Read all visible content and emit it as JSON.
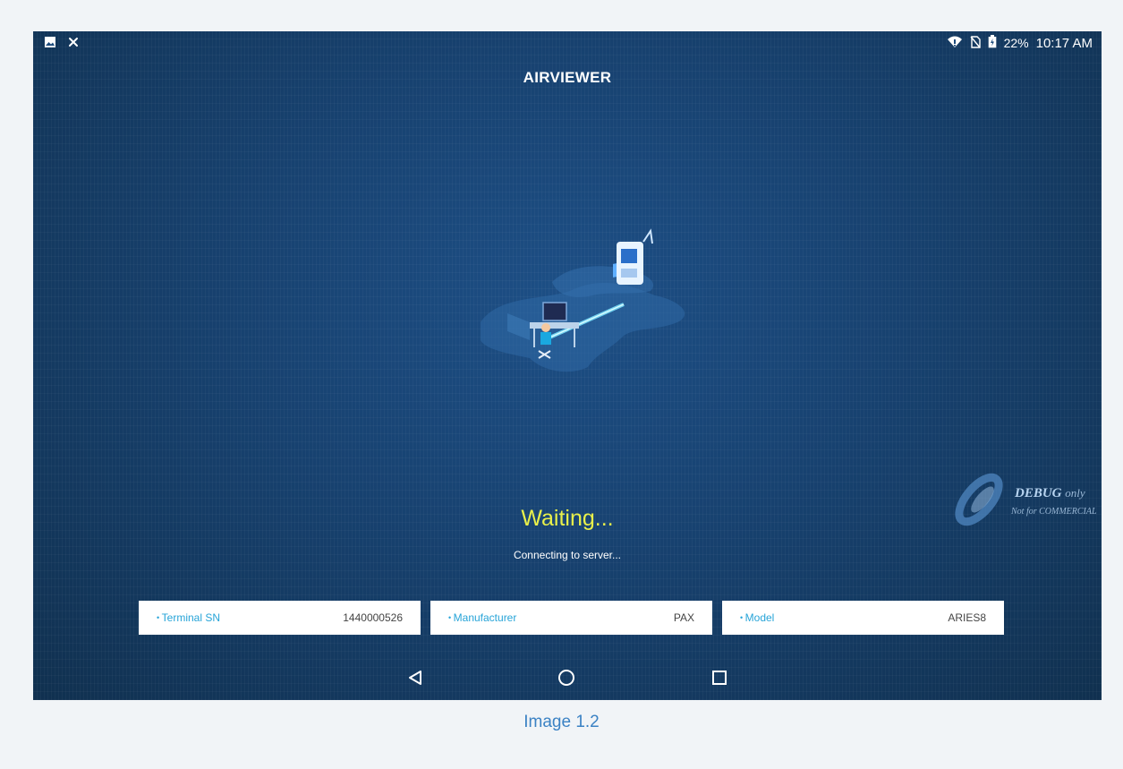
{
  "status_bar": {
    "left_icons": [
      "image-icon",
      "tools-icon"
    ],
    "right_icons": [
      "wifi-icon",
      "no-sim-icon",
      "battery-icon"
    ],
    "battery": "22%",
    "time": "10:17 AM"
  },
  "app": {
    "title": "AIRVIEWER"
  },
  "status": {
    "waiting": "Waiting...",
    "message": "Connecting to server..."
  },
  "watermark": {
    "line1": "DEBUG",
    "line1_suffix": "only",
    "line2": "Not for COMMERCIAL"
  },
  "info": [
    {
      "label": "Terminal SN",
      "value": "1440000526"
    },
    {
      "label": "Manufacturer",
      "value": "PAX"
    },
    {
      "label": "Model",
      "value": "ARIES8"
    }
  ],
  "nav": {
    "icons": [
      "back-icon",
      "home-icon",
      "recents-icon"
    ]
  },
  "caption": "Image 1.2",
  "colors": {
    "waiting_text": "#e9f04a",
    "label_accent": "#27a4d8",
    "background": "#17416f"
  }
}
